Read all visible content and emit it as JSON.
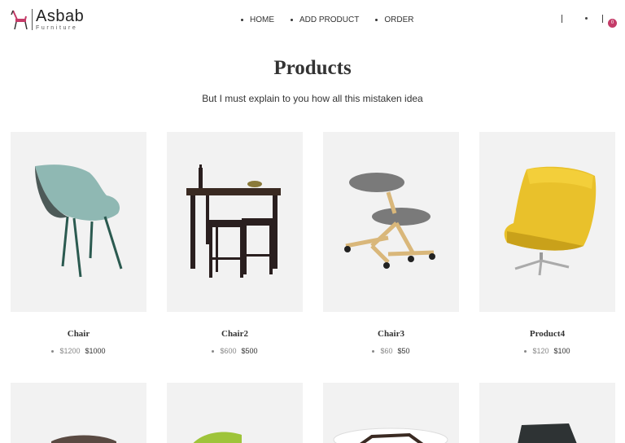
{
  "brand": {
    "name": "Asbab",
    "tagline": "Furniture"
  },
  "nav": {
    "items": [
      {
        "label": "HOME"
      },
      {
        "label": "ADD PRODUCT"
      },
      {
        "label": "ORDER"
      }
    ]
  },
  "cart": {
    "count": "0"
  },
  "section": {
    "title": "Products",
    "subtitle": "But I must explain to you how all this mistaken idea"
  },
  "products": [
    {
      "name": "Chair",
      "old_price": "$1200",
      "new_price": "$1000",
      "icon": "teal-shell-chair"
    },
    {
      "name": "Chair2",
      "old_price": "$600",
      "new_price": "$500",
      "icon": "bar-table-stools"
    },
    {
      "name": "Chair3",
      "old_price": "$60",
      "new_price": "$50",
      "icon": "kneeling-chair"
    },
    {
      "name": "Product4",
      "old_price": "$120",
      "new_price": "$100",
      "icon": "yellow-lounge-chair"
    }
  ],
  "colors": {
    "accent": "#c43b68",
    "card_bg": "#f2f2f2",
    "text": "#333333"
  }
}
